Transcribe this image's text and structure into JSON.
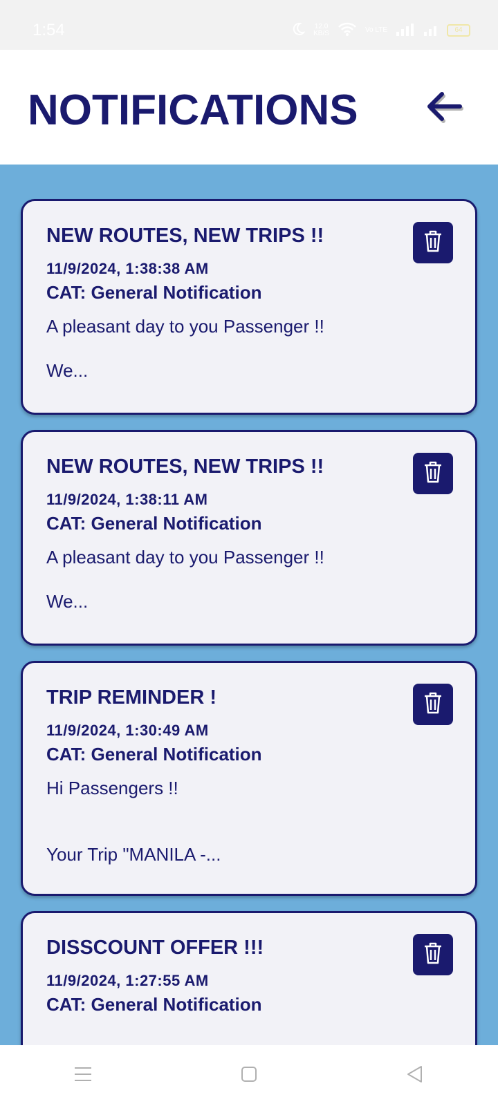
{
  "status_bar": {
    "time": "1:54",
    "net_speed": "12.0",
    "net_unit": "KB/S",
    "volte": "Vo LTE",
    "battery": "64",
    "icons": [
      "moon-icon",
      "wifi-icon",
      "signal-icon",
      "signal-icon-2",
      "battery-icon"
    ]
  },
  "header": {
    "title": "NOTIFICATIONS",
    "back_icon": "arrow-left-icon"
  },
  "notifications": [
    {
      "title": "NEW ROUTES, NEW TRIPS !!",
      "date": "11/9/2024, 1:38:38 AM",
      "category": "CAT: General Notification",
      "preview_line1": "A pleasant day to you Passenger !!",
      "preview_line2": "We...",
      "delete_icon": "trash-icon"
    },
    {
      "title": "NEW ROUTES, NEW TRIPS !!",
      "date": "11/9/2024, 1:38:11 AM",
      "category": "CAT: General Notification",
      "preview_line1": "A pleasant day to you Passenger !!",
      "preview_line2": "We...",
      "delete_icon": "trash-icon"
    },
    {
      "title": "TRIP REMINDER !",
      "date": "11/9/2024, 1:30:49 AM",
      "category": "CAT: General Notification",
      "preview_line1": "Hi Passengers !!",
      "preview_line2": "Your Trip \"MANILA -...",
      "delete_icon": "trash-icon"
    },
    {
      "title": "DISSCOUNT OFFER !!!",
      "date": "11/9/2024, 1:27:55 AM",
      "category": "CAT: General Notification",
      "delete_icon": "trash-icon"
    }
  ],
  "nav_bar": {
    "icons": [
      "menu-icon",
      "home-square-icon",
      "back-triangle-icon"
    ]
  },
  "colors": {
    "primary": "#1a1a6e",
    "background": "#6daeda",
    "card": "#f2f2f7",
    "header": "#ffffff"
  }
}
